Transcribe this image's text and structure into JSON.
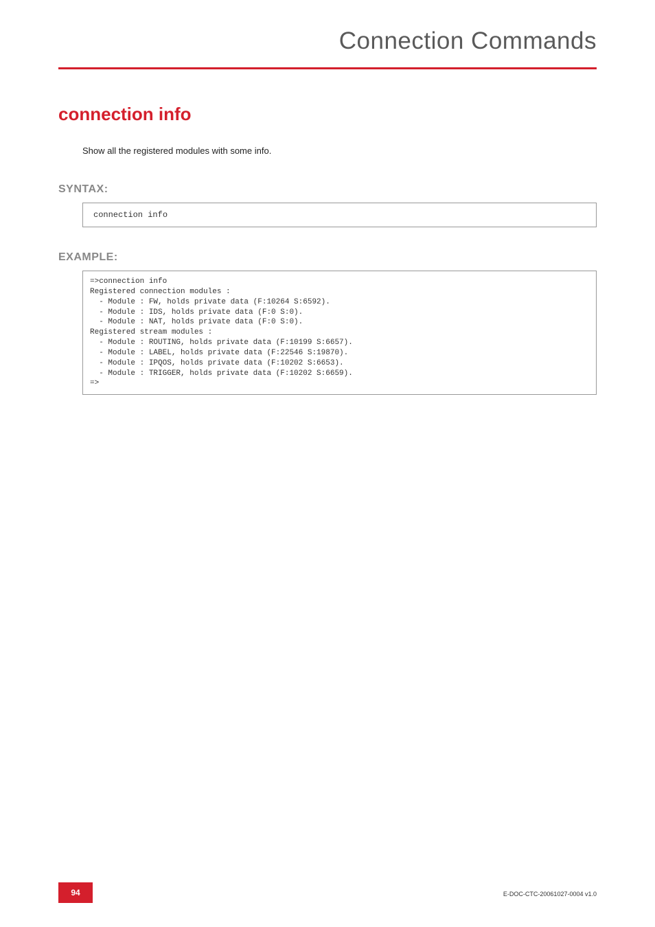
{
  "header": {
    "title": "Connection Commands"
  },
  "section": {
    "title": "connection info",
    "description": "Show all the registered modules with some info."
  },
  "syntax": {
    "label": "SYNTAX:",
    "content": "connection info"
  },
  "example": {
    "label": "EXAMPLE:",
    "content": "=>connection info\nRegistered connection modules :\n  - Module : FW, holds private data (F:10264 S:6592).\n  - Module : IDS, holds private data (F:0 S:0).\n  - Module : NAT, holds private data (F:0 S:0).\nRegistered stream modules :\n  - Module : ROUTING, holds private data (F:10199 S:6657).\n  - Module : LABEL, holds private data (F:22546 S:19870).\n  - Module : IPQOS, holds private data (F:10202 S:6653).\n  - Module : TRIGGER, holds private data (F:10202 S:6659).\n=>"
  },
  "footer": {
    "page_number": "94",
    "doc_id": "E-DOC-CTC-20061027-0004 v1.0"
  }
}
